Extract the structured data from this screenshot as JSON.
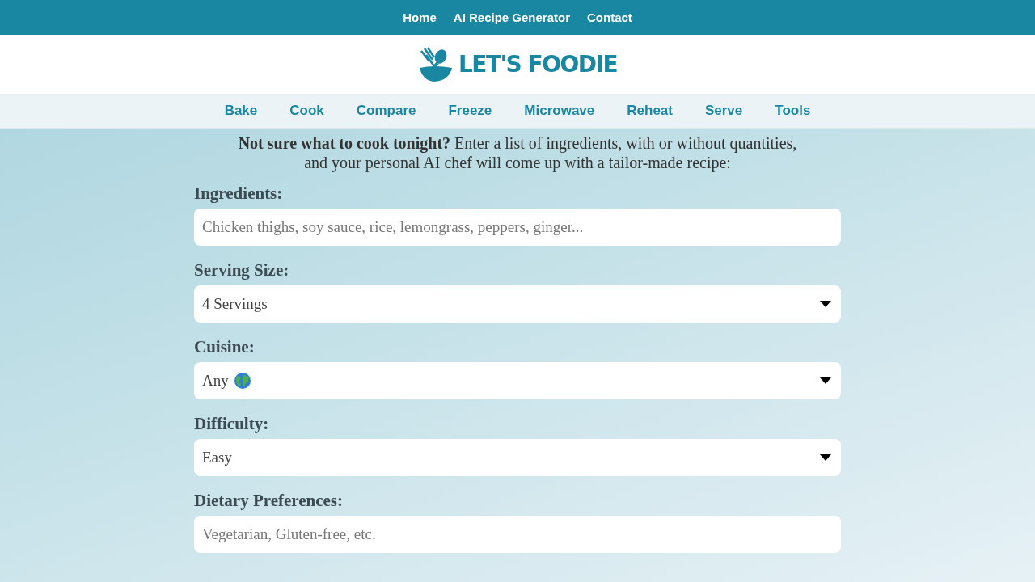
{
  "top_nav": [
    {
      "label": "Home"
    },
    {
      "label": "AI Recipe Generator"
    },
    {
      "label": "Contact"
    }
  ],
  "logo": {
    "text": "LET'S FOODIE"
  },
  "category_nav": [
    {
      "label": "Bake"
    },
    {
      "label": "Cook"
    },
    {
      "label": "Compare"
    },
    {
      "label": "Freeze"
    },
    {
      "label": "Microwave"
    },
    {
      "label": "Reheat"
    },
    {
      "label": "Serve"
    },
    {
      "label": "Tools"
    }
  ],
  "intro": "**Not sure what to cook tonight?** Enter a list of ingredients, with or without quantities, and your personal AI chef will come up with a tailor-made recipe:",
  "form": [
    {
      "kind": "text",
      "label": "Ingredients:",
      "placeholder": "Chicken thighs, soy sauce, rice, lemongrass, peppers, ginger..."
    },
    {
      "kind": "select",
      "label": "Serving Size:",
      "value": "4 Servings"
    },
    {
      "kind": "select",
      "label": "Cuisine:",
      "value": "Any"
    },
    {
      "kind": "select",
      "label": "Difficulty:",
      "value": "Easy"
    },
    {
      "kind": "text",
      "label": "Dietary Preferences:",
      "placeholder": "Vegetarian, Gluten-free, etc."
    }
  ]
}
